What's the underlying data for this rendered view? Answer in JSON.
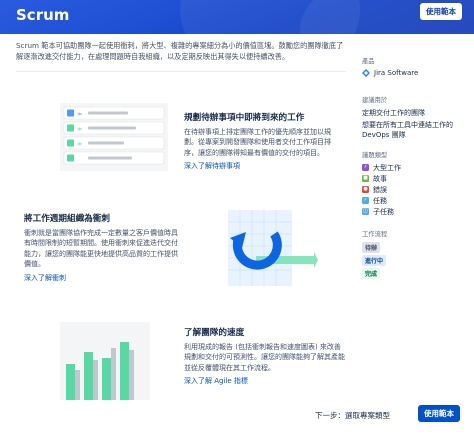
{
  "header": {
    "title": "Scrum",
    "use_template_label": "使用範本"
  },
  "intro": "Scrum 範本可協助團隊一起使用衝刺，將大型、複雜的專案細分為小的價值區塊。鼓勵您的團隊徹底了解逐漸改進交付能力，在處理問題時自我組織，以及定期反映出其得失以便持續改善。",
  "sections": [
    {
      "title": "規劃待辦事項中即將到來的工作",
      "body": "在待辦事項上排定團隊工作的優先順序並加以規劃。從專案到開發團隊和使用者交付工作項目排序，讓您的團隊得知最有價值的交付的項目。",
      "link": "深入了解待辦事項"
    },
    {
      "title": "將工作週期組織為衝刺",
      "body": "衝刺就是當團隊協作完成一定數量之客戶價值時具有時間限制的短暫期間。使用衝刺來促進迭代交付能力，讓您的團隊能更快地提供高品質的工作提供價值。",
      "link": "深入了解衝刺"
    },
    {
      "title": "了解團隊的速度",
      "body": "利用現成的報告 (包括衝刺報告和速度圖表) 來改善規劃和交付的可預測性。讓您的團隊能夠了解其產能並從反覆體現在其工作流程。",
      "link": "深入了解 Agile 指標"
    }
  ],
  "sidebar": {
    "product_label": "產品",
    "product_name": "Jira Software",
    "recommended_label": "建議用於",
    "recommended": [
      "定期交付工作的團隊",
      "想要在所有工具中連結工作的 DevOps 團隊"
    ],
    "issue_types_label": "議題類型",
    "issue_types": [
      {
        "label": "大型工作",
        "color": "#904ee2",
        "icon": "epic-icon"
      },
      {
        "label": "故事",
        "color": "#63ba3c",
        "icon": "story-icon"
      },
      {
        "label": "錯誤",
        "color": "#e5493a",
        "icon": "bug-icon"
      },
      {
        "label": "任務",
        "color": "#4bade8",
        "icon": "task-icon"
      },
      {
        "label": "子任務",
        "color": "#4bade8",
        "icon": "subtask-icon"
      }
    ],
    "workflow_label": "工作流程",
    "workflow": [
      {
        "label": "待辦",
        "bg": "#dfe1e6",
        "fg": "#42526e"
      },
      {
        "label": "進行中",
        "bg": "#deebff",
        "fg": "#0747a6"
      },
      {
        "label": "完成",
        "bg": "#e3fcef",
        "fg": "#006644"
      }
    ]
  },
  "footer": {
    "next_label": "下一步：選取專案類型",
    "use_template_label": "使用範本"
  },
  "colors": {
    "header_bg": "#1d4fd6",
    "primary": "#0052cc",
    "link": "#0052cc"
  }
}
